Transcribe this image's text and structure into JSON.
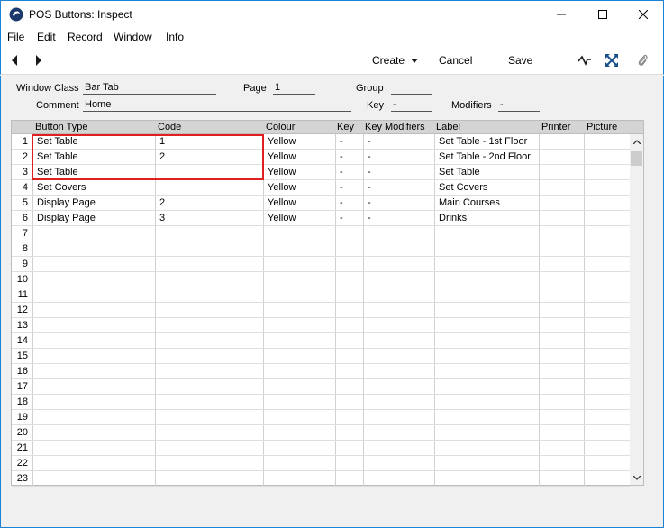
{
  "window": {
    "title": "POS Buttons: Inspect"
  },
  "menu": [
    "File",
    "Edit",
    "Record",
    "Window",
    "Info"
  ],
  "toolbar": {
    "create": "Create",
    "cancel": "Cancel",
    "save": "Save"
  },
  "header": {
    "window_class_label": "Window Class",
    "window_class": "Bar Tab",
    "page_label": "Page",
    "page": "1",
    "group_label": "Group",
    "group": "",
    "comment_label": "Comment",
    "comment": "Home",
    "key_label": "Key",
    "key": "-",
    "modifiers_label": "Modifiers",
    "modifiers": "-"
  },
  "table": {
    "columns": [
      "Button Type",
      "Code",
      "Colour",
      "Key",
      "Key Modifiers",
      "Label",
      "Printer",
      "Picture"
    ],
    "rows": [
      [
        "Set Table",
        "1",
        "Yellow",
        "-",
        "-",
        "Set Table - 1st Floor",
        "",
        ""
      ],
      [
        "Set Table",
        "2",
        "Yellow",
        "-",
        "-",
        "Set Table - 2nd Floor",
        "",
        ""
      ],
      [
        "Set Table",
        "",
        "Yellow",
        "-",
        "-",
        "Set Table",
        "",
        ""
      ],
      [
        "Set Covers",
        "",
        "Yellow",
        "-",
        "-",
        "Set Covers",
        "",
        ""
      ],
      [
        "Display Page",
        "2",
        "Yellow",
        "-",
        "-",
        "Main Courses",
        "",
        ""
      ],
      [
        "Display Page",
        "3",
        "Yellow",
        "-",
        "-",
        "Drinks",
        "",
        ""
      ]
    ],
    "row_numbers": [
      "1",
      "2",
      "3",
      "4",
      "5",
      "6",
      "7",
      "8",
      "9",
      "10",
      "11",
      "12",
      "13",
      "14",
      "15",
      "16",
      "17",
      "18",
      "19",
      "20",
      "21",
      "22",
      "23"
    ]
  },
  "colors": {
    "window_border": "#1883d7",
    "highlight": "#e0201f"
  }
}
